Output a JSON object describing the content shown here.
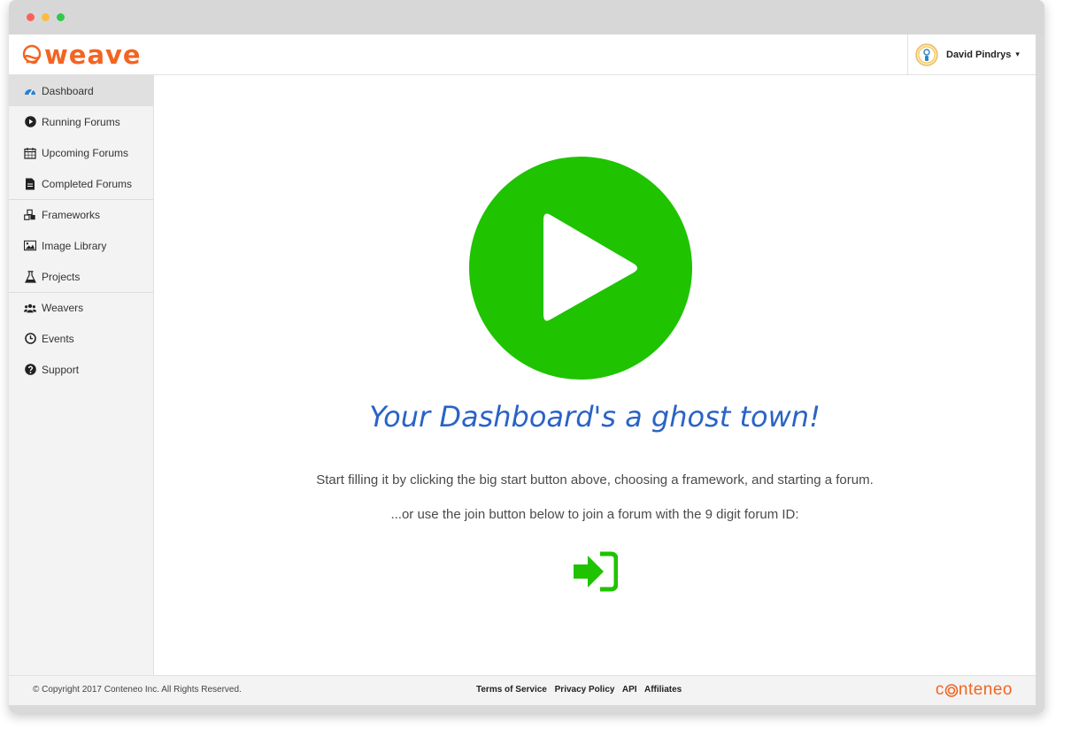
{
  "app": {
    "logo_text": "weave",
    "brand_color": "#f26522",
    "accent_green": "#1fc300",
    "heading_blue": "#2a63c6"
  },
  "user": {
    "name": "David Pindrys",
    "caret": "▾"
  },
  "sidebar": {
    "items": [
      {
        "label": "Dashboard",
        "icon": "dashboard-icon",
        "active": true
      },
      {
        "label": "Running Forums",
        "icon": "play-circle-icon"
      },
      {
        "label": "Upcoming Forums",
        "icon": "calendar-icon"
      },
      {
        "label": "Completed Forums",
        "icon": "document-icon"
      },
      {
        "label": "Frameworks",
        "icon": "cubes-icon"
      },
      {
        "label": "Image Library",
        "icon": "image-icon"
      },
      {
        "label": "Projects",
        "icon": "flask-icon"
      },
      {
        "label": "Weavers",
        "icon": "users-icon"
      },
      {
        "label": "Events",
        "icon": "clock-icon"
      },
      {
        "label": "Support",
        "icon": "question-circle-icon"
      }
    ]
  },
  "main": {
    "heading": "Your Dashboard's a ghost town!",
    "hint_start": "Start filling it by clicking the big start button above, choosing a framework, and starting a forum.",
    "hint_join": "...or use the join button below to join a forum with the 9 digit forum ID:"
  },
  "footer": {
    "copyright": "© Copyright 2017 Conteneo Inc. All Rights Reserved.",
    "links": [
      "Terms of Service",
      "Privacy Policy",
      "API",
      "Affiliates"
    ],
    "brand_left": "c",
    "brand_right": "nteneo"
  }
}
